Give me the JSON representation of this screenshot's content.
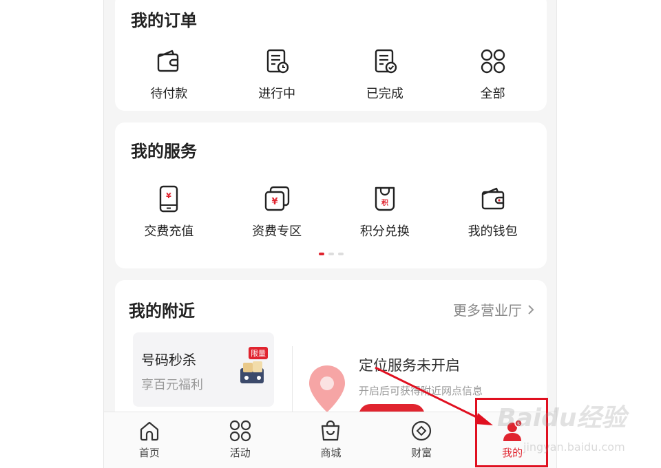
{
  "orders": {
    "title": "我的订单",
    "items": [
      {
        "label": "待付款",
        "icon": "wallet-icon"
      },
      {
        "label": "进行中",
        "icon": "doc-clock-icon"
      },
      {
        "label": "已完成",
        "icon": "doc-check-icon"
      },
      {
        "label": "全部",
        "icon": "grid-icon"
      }
    ]
  },
  "services": {
    "title": "我的服务",
    "items": [
      {
        "label": "交费充值",
        "icon": "phone-yen-icon"
      },
      {
        "label": "资费专区",
        "icon": "yen-cards-icon"
      },
      {
        "label": "积分兑换",
        "icon": "points-bag-icon"
      },
      {
        "label": "我的钱包",
        "icon": "wallet-icon"
      }
    ],
    "pager": {
      "pages": 3,
      "active": 1
    }
  },
  "nearby": {
    "title": "我的附近",
    "more_label": "更多营业厅",
    "promo": {
      "title": "号码秒杀",
      "subtitle": "享百元福利",
      "badge": "限量"
    },
    "location": {
      "title": "定位服务未开启",
      "subtitle": "开启后可获得附近网点信息"
    }
  },
  "tabbar": {
    "items": [
      {
        "label": "首页",
        "icon": "home-icon"
      },
      {
        "label": "活动",
        "icon": "grid-icon"
      },
      {
        "label": "商城",
        "icon": "shopping-bag-icon"
      },
      {
        "label": "财富",
        "icon": "coin-icon"
      },
      {
        "label": "我的",
        "icon": "profile-icon",
        "active": true
      }
    ]
  },
  "colors": {
    "accent": "#e0242f",
    "highlight_box": "#e01020"
  },
  "watermark": {
    "logo": "Baidu经验",
    "url": "jingyan.baidu.com"
  }
}
